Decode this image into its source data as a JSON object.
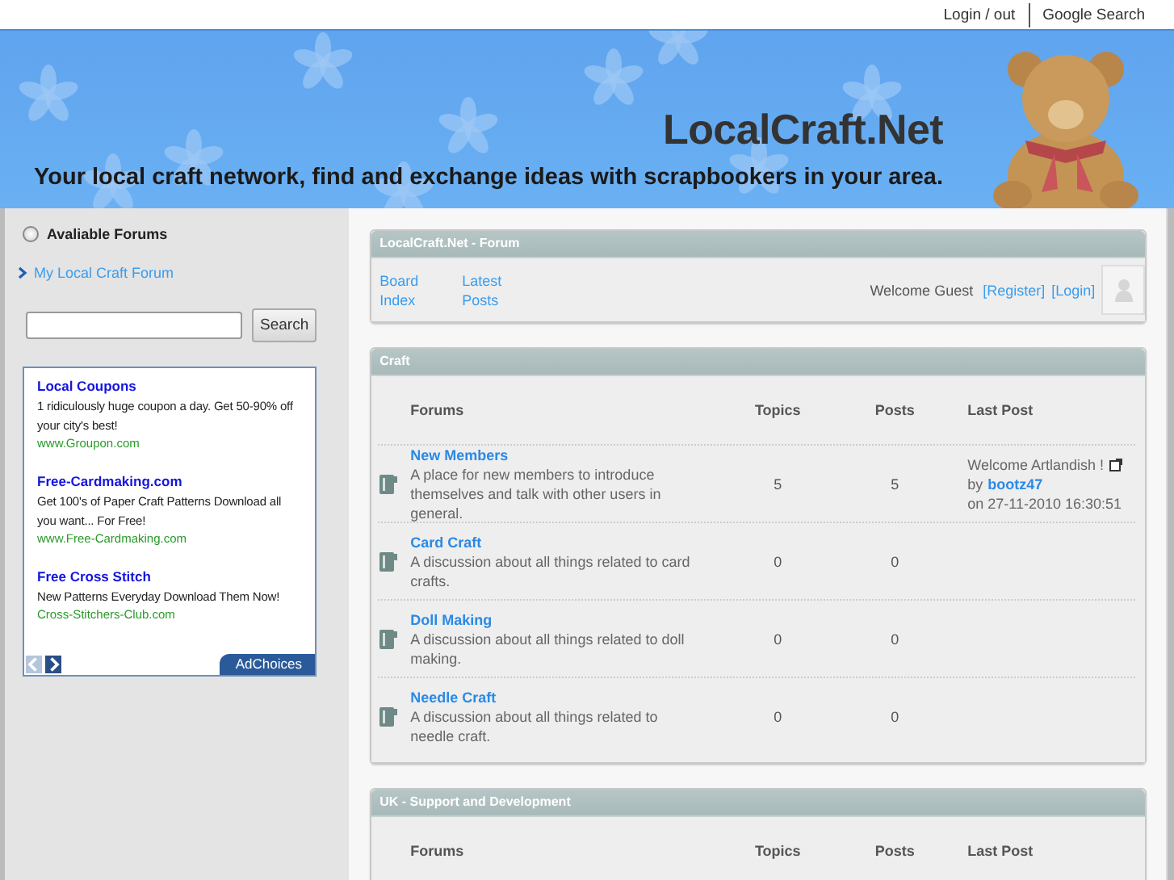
{
  "top_links": [
    "Login / out",
    "Google Search"
  ],
  "header": {
    "title": "LocalCraft.Net",
    "tagline": "Your local craft network, find and exchange ideas with scrapbookers in your area."
  },
  "sidebar": {
    "heading": "Avaliable Forums",
    "selected": false,
    "links": [
      "My Local Craft Forum"
    ],
    "search": {
      "button": "Search"
    },
    "ads": [
      {
        "title": "Local Coupons",
        "text": "1 ridiculously huge coupon a day. Get 50-90% off your city's best!",
        "url": "www.Groupon.com"
      },
      {
        "title": "Free-Cardmaking.com",
        "text": "Get 100's of Paper Craft Patterns Download all you want... For Free!",
        "url": "www.Free-Cardmaking.com"
      },
      {
        "title": "Free Cross Stitch",
        "text": "New Patterns Everyday Download Them Now!",
        "url": "Cross-Stitchers-Club.com"
      }
    ],
    "ad_choices": "AdChoices"
  },
  "forum_header": {
    "title": "LocalCraft.Net - Forum",
    "nav": [
      "Board Index",
      "Latest Posts"
    ],
    "welcome": "Welcome Guest",
    "auth_links": [
      "[Register]",
      "[Login]"
    ]
  },
  "categories": [
    {
      "title": "Craft",
      "columns": [
        "Forums",
        "Topics",
        "Posts",
        "Last Post"
      ],
      "forums": [
        {
          "name": "New Members",
          "description": "A place for new members to introduce themselves and talk with other users in general.",
          "topics": "5",
          "posts": "5",
          "last_post": {
            "title": "Welcome Artlandish !",
            "by": "by",
            "author": "bootz47",
            "date": "on 27-11-2010 16:30:51"
          }
        },
        {
          "name": "Card Craft",
          "description": "A discussion about all things related to card crafts.",
          "topics": "0",
          "posts": "0"
        },
        {
          "name": "Doll Making",
          "description": "A discussion about all things related to doll making.",
          "topics": "0",
          "posts": "0"
        },
        {
          "name": "Needle Craft",
          "description": "A discussion about all things related to needle craft.",
          "topics": "0",
          "posts": "0"
        }
      ]
    },
    {
      "title": "UK - Support and Development",
      "columns": [
        "Forums",
        "Topics",
        "Posts",
        "Last Post"
      ]
    }
  ]
}
